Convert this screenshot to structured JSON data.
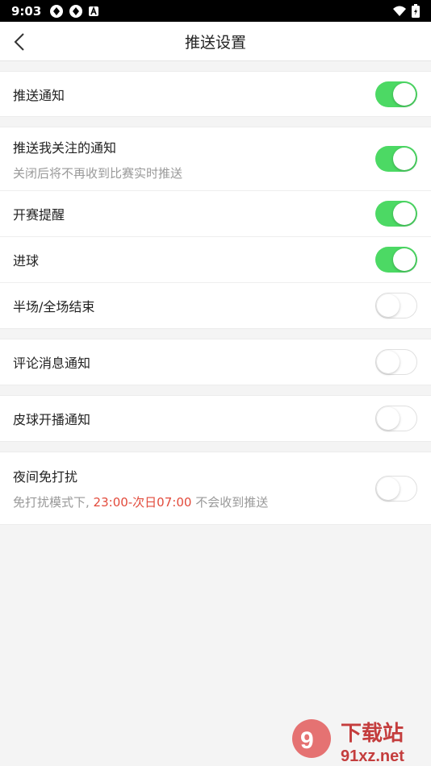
{
  "status_bar": {
    "time": "9:03"
  },
  "header": {
    "title": "推送设置"
  },
  "groups": [
    {
      "items": [
        {
          "label": "推送通知",
          "on": true
        }
      ]
    },
    {
      "items": [
        {
          "label": "推送我关注的通知",
          "sub": "关闭后将不再收到比赛实时推送",
          "on": true
        },
        {
          "label": "开赛提醒",
          "on": true
        },
        {
          "label": "进球",
          "on": true
        },
        {
          "label": "半场/全场结束",
          "on": false
        }
      ]
    },
    {
      "items": [
        {
          "label": "评论消息通知",
          "on": false
        }
      ]
    },
    {
      "items": [
        {
          "label": "皮球开播通知",
          "on": false
        }
      ]
    },
    {
      "items": [
        {
          "label": "夜间免打扰",
          "sub_prefix": "免打扰模式下, ",
          "sub_highlight": "23:00-次日07:00",
          "sub_suffix": " 不会收到推送",
          "on": false
        }
      ]
    }
  ],
  "watermark": {
    "brand": "下载站",
    "domain": "91xz.net"
  },
  "colors": {
    "toggle_on": "#4cd964",
    "highlight": "#e24a3b"
  }
}
